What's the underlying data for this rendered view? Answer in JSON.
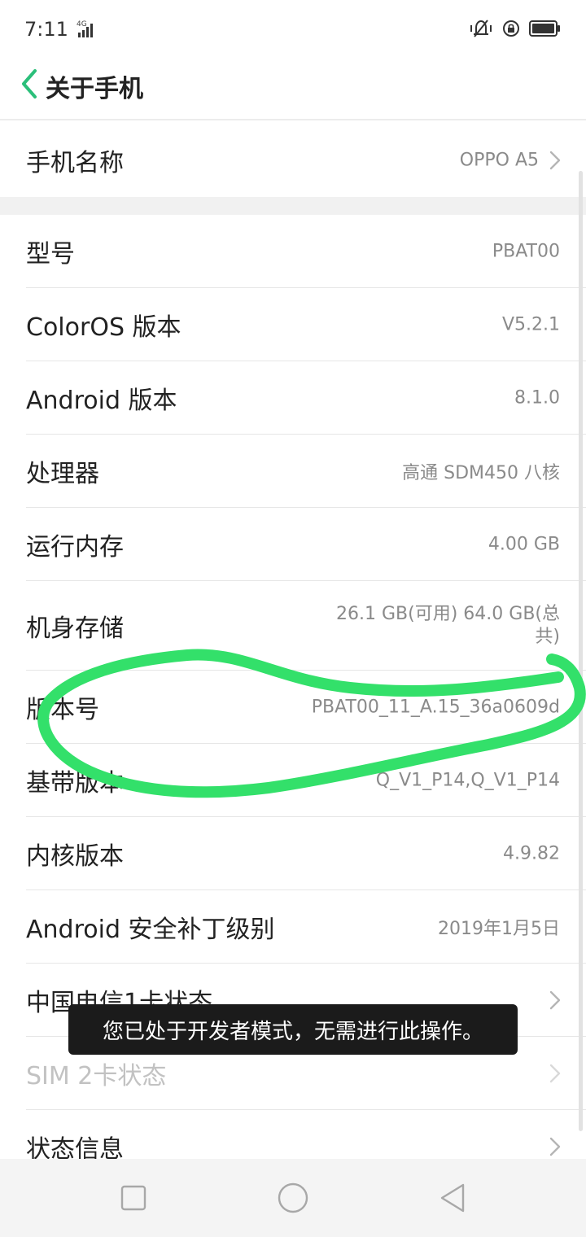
{
  "status_bar": {
    "time": "7:11",
    "network": "4G",
    "icons": [
      "signal-bars-icon",
      "vibrate-icon",
      "rotation-lock-icon",
      "battery-icon"
    ]
  },
  "header": {
    "title": "关于手机",
    "back_icon": "chevron-left-icon"
  },
  "phone_name": {
    "label": "手机名称",
    "value": "OPPO A5"
  },
  "info_rows": [
    {
      "label": "型号",
      "value": "PBAT00"
    },
    {
      "label": "ColorOS 版本",
      "value": "V5.2.1"
    },
    {
      "label": "Android 版本",
      "value": "8.1.0"
    },
    {
      "label": "处理器",
      "value": "高通 SDM450 八核"
    },
    {
      "label": "运行内存",
      "value": "4.00 GB"
    },
    {
      "label": "机身存储",
      "value": "26.1 GB(可用)    64.0 GB(总共)"
    },
    {
      "label": "版本号",
      "value": "PBAT00_11_A.15_36a0609d"
    },
    {
      "label": "基带版本",
      "value": "Q_V1_P14,Q_V1_P14"
    },
    {
      "label": "内核版本",
      "value": "4.9.82"
    },
    {
      "label": "Android 安全补丁级别",
      "value": "2019年1月5日"
    },
    {
      "label": "中国电信1卡状态",
      "value": ""
    },
    {
      "label": "SIM 2卡状态",
      "value": ""
    },
    {
      "label": "状态信息",
      "value": ""
    }
  ],
  "toast": {
    "text": "您已处于开发者模式，无需进行此操作。"
  },
  "nav_bar": {
    "icons": [
      "recent-apps-icon",
      "home-icon",
      "back-triangle-icon"
    ]
  },
  "colors": {
    "accent": "#2bbf7a",
    "annotation": "#33e06a",
    "toast_bg": "#1b1b1b"
  }
}
